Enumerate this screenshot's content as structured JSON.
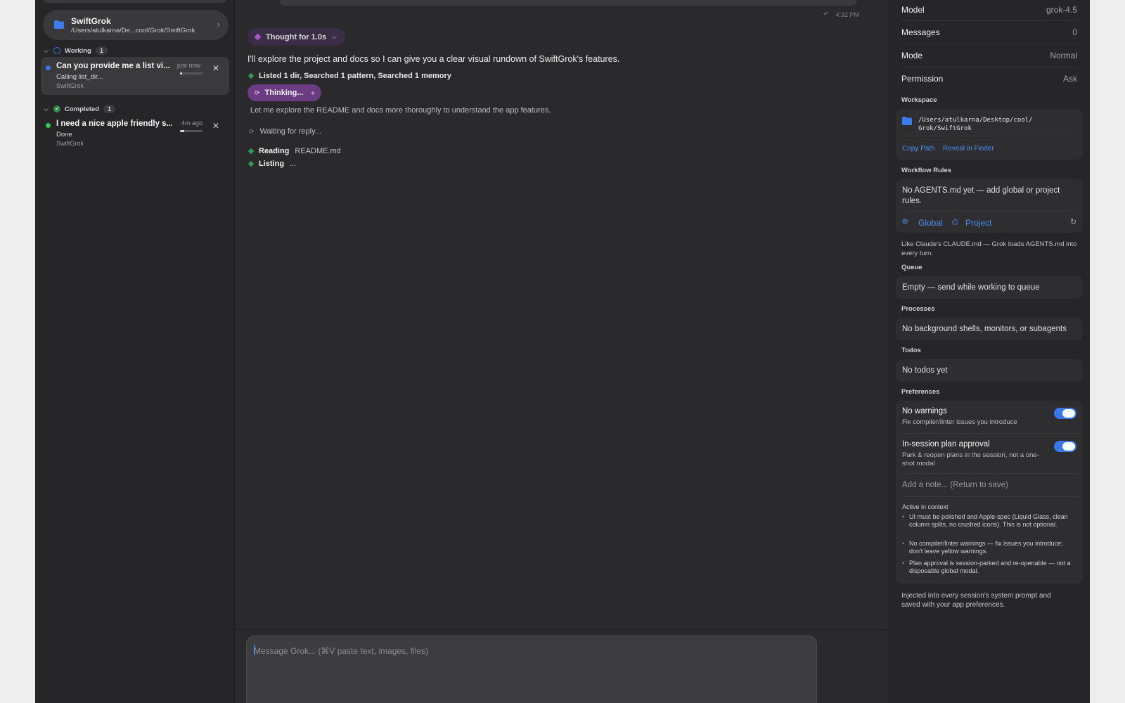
{
  "sidebar": {
    "workspace": {
      "name": "SwiftGrok",
      "path": "/Users/atulkarna/De...cool/Grok/SwiftGrok"
    },
    "sections": [
      {
        "label": "Working",
        "count": "1"
      },
      {
        "label": "Completed",
        "count": "1"
      }
    ],
    "tasks": [
      {
        "title": "Can you provide me a list vi...",
        "subtitle": "Calling list_dir...",
        "workspace": "SwiftGrok",
        "time": "just now",
        "status_color": "#3a78e8",
        "progress": 0.1
      },
      {
        "title": "I need a nice apple friendly s...",
        "subtitle": "Done",
        "workspace": "SwiftGrok",
        "time": "4m ago",
        "status_color": "#34c759",
        "progress": 0.2
      }
    ]
  },
  "chat": {
    "timestamp": "4:32 PM",
    "thought_label": "Thought for 1.0s",
    "message": "I'll explore the project and docs so I can give you a clear visual rundown of SwiftGrok's features.",
    "tool_summary": "Listed 1 dir, Searched 1 pattern, Searched 1 memory",
    "thinking_label": "Thinking...",
    "explore_text": "Let me explore the README and docs more thoroughly to understand the app features.",
    "waiting_text": "Waiting for reply...",
    "steps": [
      {
        "verb": "Reading",
        "arg": "README.md"
      },
      {
        "verb": "Listing",
        "arg": "..."
      }
    ],
    "composer_placeholder": "Message Grok...  (⌘V paste text, images, files)"
  },
  "panel": {
    "info": [
      {
        "key": "Model",
        "value": "grok-4.5"
      },
      {
        "key": "Messages",
        "value": "0"
      },
      {
        "key": "Mode",
        "value": "Normal"
      },
      {
        "key": "Permission",
        "value": "Ask"
      }
    ],
    "workspace_label": "Workspace",
    "workspace_path": "/Users/atulkarna/Desktop/cool/ Grok/SwiftGrok",
    "copy_path": "Copy Path",
    "reveal": "Reveal in Finder",
    "rules_label": "Workflow Rules",
    "rules_text": "No AGENTS.md yet — add global or project rules.",
    "global": "Global",
    "project": "Project",
    "rules_hint": "Like Claude's CLAUDE.md — Grok loads AGENTS.md into every turn.",
    "queue_label": "Queue",
    "queue_text": "Empty — send while working to queue",
    "processes_label": "Processes",
    "processes_text": "No background shells, monitors, or subagents",
    "todos_label": "Todos",
    "todos_text": "No todos yet",
    "prefs_label": "Preferences",
    "prefs": [
      {
        "title": "No warnings",
        "desc": "Fix compiler/linter issues you introduce",
        "on": true
      },
      {
        "title": "In-session plan approval",
        "desc": "Park & reopen plans in the session, not a one-shot modal",
        "on": true
      }
    ],
    "note_placeholder": "Add a note... (Return to save)",
    "context_label": "Active in context",
    "context_items": [
      "UI must be polished and Apple-spec (Liquid Glass, clean column splits, no crushed icons). This is not optional.",
      "No compiler/linter warnings — fix issues you introduce; don't leave yellow warnings.",
      "Plan approval is session-parked and re-openable — not a disposable global modal."
    ],
    "footer": "Injected into every session's system prompt and saved with your app preferences."
  }
}
